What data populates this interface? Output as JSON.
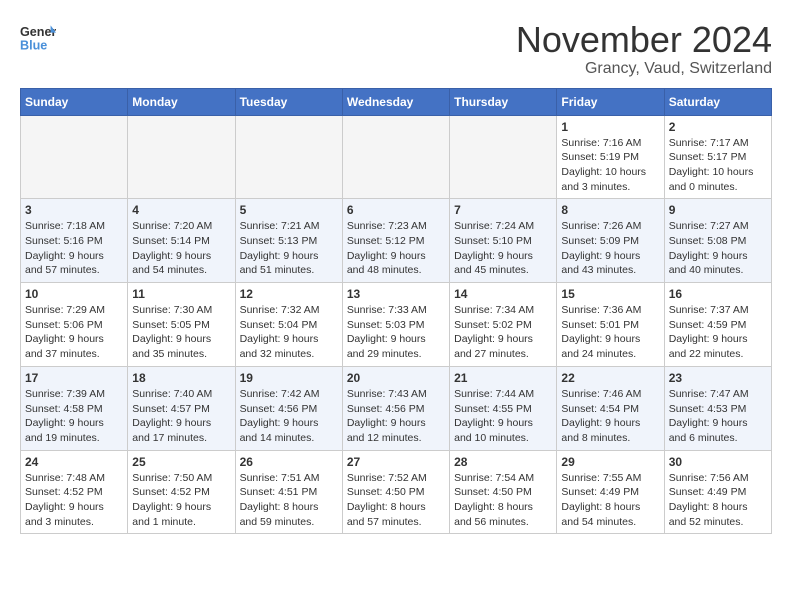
{
  "header": {
    "logo_line1": "General",
    "logo_line2": "Blue",
    "title": "November 2024",
    "subtitle": "Grancy, Vaud, Switzerland"
  },
  "weekdays": [
    "Sunday",
    "Monday",
    "Tuesday",
    "Wednesday",
    "Thursday",
    "Friday",
    "Saturday"
  ],
  "weeks": [
    {
      "days": [
        {
          "num": "",
          "empty": true
        },
        {
          "num": "",
          "empty": true
        },
        {
          "num": "",
          "empty": true
        },
        {
          "num": "",
          "empty": true
        },
        {
          "num": "",
          "empty": true
        },
        {
          "num": "1",
          "sunrise": "Sunrise: 7:16 AM",
          "sunset": "Sunset: 5:19 PM",
          "daylight": "Daylight: 10 hours and 3 minutes."
        },
        {
          "num": "2",
          "sunrise": "Sunrise: 7:17 AM",
          "sunset": "Sunset: 5:17 PM",
          "daylight": "Daylight: 10 hours and 0 minutes."
        }
      ]
    },
    {
      "days": [
        {
          "num": "3",
          "sunrise": "Sunrise: 7:18 AM",
          "sunset": "Sunset: 5:16 PM",
          "daylight": "Daylight: 9 hours and 57 minutes."
        },
        {
          "num": "4",
          "sunrise": "Sunrise: 7:20 AM",
          "sunset": "Sunset: 5:14 PM",
          "daylight": "Daylight: 9 hours and 54 minutes."
        },
        {
          "num": "5",
          "sunrise": "Sunrise: 7:21 AM",
          "sunset": "Sunset: 5:13 PM",
          "daylight": "Daylight: 9 hours and 51 minutes."
        },
        {
          "num": "6",
          "sunrise": "Sunrise: 7:23 AM",
          "sunset": "Sunset: 5:12 PM",
          "daylight": "Daylight: 9 hours and 48 minutes."
        },
        {
          "num": "7",
          "sunrise": "Sunrise: 7:24 AM",
          "sunset": "Sunset: 5:10 PM",
          "daylight": "Daylight: 9 hours and 45 minutes."
        },
        {
          "num": "8",
          "sunrise": "Sunrise: 7:26 AM",
          "sunset": "Sunset: 5:09 PM",
          "daylight": "Daylight: 9 hours and 43 minutes."
        },
        {
          "num": "9",
          "sunrise": "Sunrise: 7:27 AM",
          "sunset": "Sunset: 5:08 PM",
          "daylight": "Daylight: 9 hours and 40 minutes."
        }
      ]
    },
    {
      "days": [
        {
          "num": "10",
          "sunrise": "Sunrise: 7:29 AM",
          "sunset": "Sunset: 5:06 PM",
          "daylight": "Daylight: 9 hours and 37 minutes."
        },
        {
          "num": "11",
          "sunrise": "Sunrise: 7:30 AM",
          "sunset": "Sunset: 5:05 PM",
          "daylight": "Daylight: 9 hours and 35 minutes."
        },
        {
          "num": "12",
          "sunrise": "Sunrise: 7:32 AM",
          "sunset": "Sunset: 5:04 PM",
          "daylight": "Daylight: 9 hours and 32 minutes."
        },
        {
          "num": "13",
          "sunrise": "Sunrise: 7:33 AM",
          "sunset": "Sunset: 5:03 PM",
          "daylight": "Daylight: 9 hours and 29 minutes."
        },
        {
          "num": "14",
          "sunrise": "Sunrise: 7:34 AM",
          "sunset": "Sunset: 5:02 PM",
          "daylight": "Daylight: 9 hours and 27 minutes."
        },
        {
          "num": "15",
          "sunrise": "Sunrise: 7:36 AM",
          "sunset": "Sunset: 5:01 PM",
          "daylight": "Daylight: 9 hours and 24 minutes."
        },
        {
          "num": "16",
          "sunrise": "Sunrise: 7:37 AM",
          "sunset": "Sunset: 4:59 PM",
          "daylight": "Daylight: 9 hours and 22 minutes."
        }
      ]
    },
    {
      "days": [
        {
          "num": "17",
          "sunrise": "Sunrise: 7:39 AM",
          "sunset": "Sunset: 4:58 PM",
          "daylight": "Daylight: 9 hours and 19 minutes."
        },
        {
          "num": "18",
          "sunrise": "Sunrise: 7:40 AM",
          "sunset": "Sunset: 4:57 PM",
          "daylight": "Daylight: 9 hours and 17 minutes."
        },
        {
          "num": "19",
          "sunrise": "Sunrise: 7:42 AM",
          "sunset": "Sunset: 4:56 PM",
          "daylight": "Daylight: 9 hours and 14 minutes."
        },
        {
          "num": "20",
          "sunrise": "Sunrise: 7:43 AM",
          "sunset": "Sunset: 4:56 PM",
          "daylight": "Daylight: 9 hours and 12 minutes."
        },
        {
          "num": "21",
          "sunrise": "Sunrise: 7:44 AM",
          "sunset": "Sunset: 4:55 PM",
          "daylight": "Daylight: 9 hours and 10 minutes."
        },
        {
          "num": "22",
          "sunrise": "Sunrise: 7:46 AM",
          "sunset": "Sunset: 4:54 PM",
          "daylight": "Daylight: 9 hours and 8 minutes."
        },
        {
          "num": "23",
          "sunrise": "Sunrise: 7:47 AM",
          "sunset": "Sunset: 4:53 PM",
          "daylight": "Daylight: 9 hours and 6 minutes."
        }
      ]
    },
    {
      "days": [
        {
          "num": "24",
          "sunrise": "Sunrise: 7:48 AM",
          "sunset": "Sunset: 4:52 PM",
          "daylight": "Daylight: 9 hours and 3 minutes."
        },
        {
          "num": "25",
          "sunrise": "Sunrise: 7:50 AM",
          "sunset": "Sunset: 4:52 PM",
          "daylight": "Daylight: 9 hours and 1 minute."
        },
        {
          "num": "26",
          "sunrise": "Sunrise: 7:51 AM",
          "sunset": "Sunset: 4:51 PM",
          "daylight": "Daylight: 8 hours and 59 minutes."
        },
        {
          "num": "27",
          "sunrise": "Sunrise: 7:52 AM",
          "sunset": "Sunset: 4:50 PM",
          "daylight": "Daylight: 8 hours and 57 minutes."
        },
        {
          "num": "28",
          "sunrise": "Sunrise: 7:54 AM",
          "sunset": "Sunset: 4:50 PM",
          "daylight": "Daylight: 8 hours and 56 minutes."
        },
        {
          "num": "29",
          "sunrise": "Sunrise: 7:55 AM",
          "sunset": "Sunset: 4:49 PM",
          "daylight": "Daylight: 8 hours and 54 minutes."
        },
        {
          "num": "30",
          "sunrise": "Sunrise: 7:56 AM",
          "sunset": "Sunset: 4:49 PM",
          "daylight": "Daylight: 8 hours and 52 minutes."
        }
      ]
    }
  ]
}
